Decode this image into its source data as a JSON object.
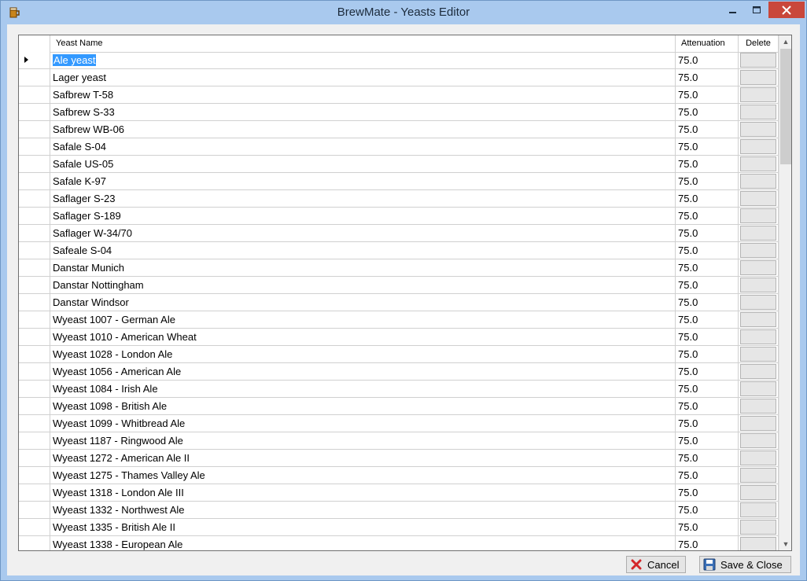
{
  "window": {
    "title": "BrewMate - Yeasts Editor"
  },
  "grid": {
    "columns": {
      "name": "Yeast Name",
      "attenuation": "Attenuation",
      "delete": "Delete"
    },
    "rows": [
      {
        "name": "Ale yeast",
        "attenuation": "75.0"
      },
      {
        "name": "Lager yeast",
        "attenuation": "75.0"
      },
      {
        "name": "Safbrew T-58",
        "attenuation": "75.0"
      },
      {
        "name": "Safbrew S-33",
        "attenuation": "75.0"
      },
      {
        "name": "Safbrew WB-06",
        "attenuation": "75.0"
      },
      {
        "name": "Safale S-04",
        "attenuation": "75.0"
      },
      {
        "name": "Safale US-05",
        "attenuation": "75.0"
      },
      {
        "name": "Safale K-97",
        "attenuation": "75.0"
      },
      {
        "name": "Saflager S-23",
        "attenuation": "75.0"
      },
      {
        "name": "Saflager S-189",
        "attenuation": "75.0"
      },
      {
        "name": "Saflager W-34/70",
        "attenuation": "75.0"
      },
      {
        "name": "Safeale S-04",
        "attenuation": "75.0"
      },
      {
        "name": "Danstar Munich",
        "attenuation": "75.0"
      },
      {
        "name": "Danstar Nottingham",
        "attenuation": "75.0"
      },
      {
        "name": "Danstar Windsor",
        "attenuation": "75.0"
      },
      {
        "name": "Wyeast 1007 - German Ale",
        "attenuation": "75.0"
      },
      {
        "name": "Wyeast 1010 - American Wheat",
        "attenuation": "75.0"
      },
      {
        "name": "Wyeast 1028 - London Ale",
        "attenuation": "75.0"
      },
      {
        "name": "Wyeast 1056 - American Ale",
        "attenuation": "75.0"
      },
      {
        "name": "Wyeast 1084 - Irish Ale",
        "attenuation": "75.0"
      },
      {
        "name": "Wyeast 1098 - British Ale",
        "attenuation": "75.0"
      },
      {
        "name": "Wyeast 1099 - Whitbread Ale",
        "attenuation": "75.0"
      },
      {
        "name": "Wyeast 1187 - Ringwood Ale",
        "attenuation": "75.0"
      },
      {
        "name": "Wyeast 1272 - American Ale II",
        "attenuation": "75.0"
      },
      {
        "name": "Wyeast 1275 - Thames Valley Ale",
        "attenuation": "75.0"
      },
      {
        "name": "Wyeast 1318 - London Ale III",
        "attenuation": "75.0"
      },
      {
        "name": "Wyeast 1332 - Northwest Ale",
        "attenuation": "75.0"
      },
      {
        "name": "Wyeast 1335 - British Ale II",
        "attenuation": "75.0"
      },
      {
        "name": "Wyeast 1338 - European Ale",
        "attenuation": "75.0"
      }
    ]
  },
  "buttons": {
    "cancel": "Cancel",
    "save_close": "Save & Close"
  },
  "icons": {
    "app": "brewmate-app-icon",
    "cancel": "red-x-icon",
    "save": "floppy-disk-icon"
  },
  "colors": {
    "titlebar": "#a9c9ee",
    "close_button": "#c9473b",
    "selection": "#3399ff"
  }
}
